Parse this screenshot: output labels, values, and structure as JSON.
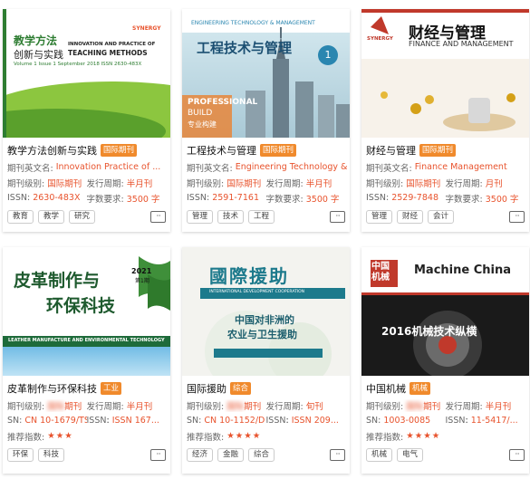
{
  "labels": {
    "en_name": "期刊英文名:",
    "level": "期刊级别:",
    "period": "发行周期:",
    "issn": "ISSN:",
    "words": "字数要求:",
    "sn": "SN:",
    "issn2": "ISSN",
    "recommend": "推荐指数:"
  },
  "journals": [
    {
      "title": "教学方法创新与实践",
      "tag": "国际期刊",
      "en_name": "Innovation Practice of ...",
      "level": "国际期刊",
      "period": "半月刊",
      "issn": "2630-483X",
      "words": "3500 字",
      "keywords": [
        "教育",
        "教学",
        "研究"
      ],
      "cover": {
        "cn_title": "教学方法",
        "cn_sub": "创新与实践",
        "en_lines": [
          "INNOVATION AND PRACTICE OF",
          "TEACHING METHODS"
        ],
        "vol": "Volume 1 Issue 1 September 2018 ISSN 2630-483X",
        "brand": "SYNERGY"
      }
    },
    {
      "title": "工程技术与管理",
      "tag": "国际期刊",
      "en_name": "Engineering Technology & ...",
      "level": "国际期刊",
      "period": "半月刊",
      "issn": "2591-7161",
      "words": "3500 字",
      "keywords": [
        "管理",
        "技术",
        "工程"
      ],
      "cover": {
        "en_header": "ENGINEERING TECHNOLOGY & MANAGEMENT",
        "cn_title": "工程技术与管理",
        "badge": "1",
        "professional": "PROFESSIONAL",
        "build": "BUILD",
        "cn_small": "专业构建"
      }
    },
    {
      "title": "财经与管理",
      "tag": "国际期刊",
      "en_name": "Finance Management",
      "level": "国际期刊",
      "period": "月刊",
      "issn": "2529-7848",
      "words": "3500 字",
      "keywords": [
        "管理",
        "财经",
        "会计"
      ],
      "cover": {
        "brand": "SYNERGY",
        "cn_title": "财经与管理",
        "en_title": "FINANCE AND MANAGEMENT"
      }
    },
    {
      "title": "皮革制作与环保科技",
      "tag": "工业",
      "level": "期刊",
      "period": "半月刊",
      "sn": "CN 10-1679/TS",
      "issn": "ISSN 167...",
      "stars": "★★★",
      "keywords": [
        "环保",
        "科技"
      ],
      "cover": {
        "line1": "皮革制作与",
        "line2": "环保科技",
        "year": "2021",
        "issue": "第1期",
        "en": "LEATHER MANUFACTURE AND ENVIRONMENTAL TECHNOLOGY"
      }
    },
    {
      "title": "国际援助",
      "tag": "综合",
      "level": "期刊",
      "period": "旬刊",
      "sn": "CN 10-1152/D",
      "issn": "ISSN 209...",
      "stars": "★★★★",
      "keywords": [
        "经济",
        "金融",
        "综合"
      ],
      "cover": {
        "cn_title": "國際援助",
        "en": "INTERNATIONAL DEVELOPMENT COOPERATION",
        "headline1": "中国对非洲的",
        "headline2": "农业与卫生援助"
      }
    },
    {
      "title": "中国机械",
      "tag": "机械",
      "level": "期刊",
      "period": "半月刊",
      "sn": "1003-0085",
      "issn": "11-5417/...",
      "stars": "★★★★",
      "keywords": [
        "机械",
        "电气"
      ],
      "cover": {
        "logo": "中国机械",
        "en": "Machine China",
        "headline": "2016机械技术纵横"
      }
    }
  ]
}
